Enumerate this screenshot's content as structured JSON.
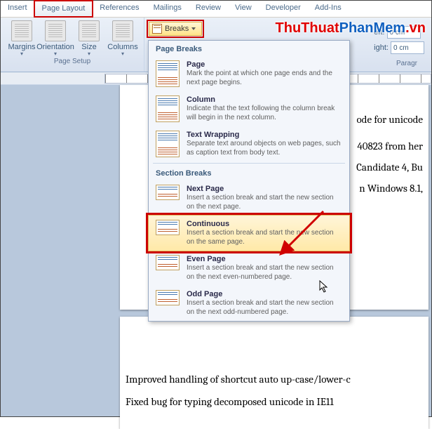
{
  "tabs": {
    "insert": "Insert",
    "page_layout": "Page Layout",
    "references": "References",
    "mailings": "Mailings",
    "review": "Review",
    "view": "View",
    "developer": "Developer",
    "addins": "Add-Ins"
  },
  "ribbon": {
    "margins": "Margins",
    "orientation": "Orientation",
    "size": "Size",
    "columns": "Columns",
    "breaks": "Breaks",
    "page_setup": "Page Setup",
    "left": "eft:",
    "right": "ight:",
    "val": "0 cm",
    "paragraph": "Paragr"
  },
  "menu": {
    "page_breaks": "Page Breaks",
    "section_breaks": "Section Breaks",
    "page": {
      "t": "Page",
      "d": "Mark the point at which one page ends and the next page begins."
    },
    "column": {
      "t": "Column",
      "d": "Indicate that the text following the column break will begin in the next column."
    },
    "textwrap": {
      "t": "Text Wrapping",
      "d": "Separate text around objects on web pages, such as caption text from body text."
    },
    "nextpage": {
      "t": "Next Page",
      "d": "Insert a section break and start the new section on the next page."
    },
    "continuous": {
      "t": "Continuous",
      "d": "Insert a section break and start the new section on the same page."
    },
    "evenpage": {
      "t": "Even Page",
      "d": "Insert a section break and start the new section on the next even-numbered page."
    },
    "oddpage": {
      "t": "Odd Page",
      "d": "Insert a section break and start the new section on the next odd-numbered page."
    }
  },
  "doc": {
    "l1": "ode for unicode",
    "l2": "40823 from her",
    "l3": "Candidate 4, Bu",
    "l4": "n Windows 8.1,",
    "l5": "Improved handling of shortcut auto up-case/lower-c",
    "l6": "Fixed bug for typing decomposed unicode in IE11"
  },
  "watermark": {
    "a": "ThuThuat",
    "b": "PhanMem",
    "c": ".vn"
  }
}
